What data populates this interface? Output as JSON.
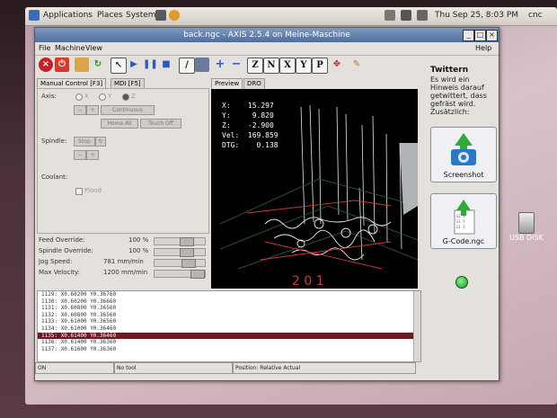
{
  "panel": {
    "menus": [
      "Applications",
      "Places",
      "System"
    ],
    "clock": "Thu Sep 25,  8:03 PM",
    "user": "cnc"
  },
  "desktop": {
    "usb_label": "USB DISK"
  },
  "window": {
    "title": "back.ngc - AXIS 2.5.4 on Meine-Maschine",
    "menu": [
      "File",
      "Machine",
      "View"
    ],
    "help": "Help"
  },
  "toolbar": {
    "letter_buttons": [
      "Z",
      "N",
      "X",
      "Y",
      "P"
    ]
  },
  "tabs": {
    "manual": "Manual Control [F3]",
    "mdi": "MDI [F5]"
  },
  "controls": {
    "axis_label": "Axis:",
    "axes": [
      "X",
      "Y",
      "Z"
    ],
    "selected_axis": "Z",
    "jog_mode": "Continuous",
    "home_all": "Home All",
    "touch_off": "Touch Off",
    "spindle_label": "Spindle:",
    "spindle_stop": "Stop",
    "coolant_label": "Coolant:",
    "flood": "Flood",
    "feed_override_label": "Feed Override:",
    "feed_override_value": "100 %",
    "spindle_override_label": "Spindle Override:",
    "spindle_override_value": "100 %",
    "jog_speed_label": "Jog Speed:",
    "jog_speed_value": "781 mm/min",
    "max_velocity_label": "Max Velocity:",
    "max_velocity_value": "1200 mm/min"
  },
  "preview_tabs": {
    "preview": "Preview",
    "dro": "DRO"
  },
  "dro": [
    {
      "axis": "X:",
      "value": "15.297"
    },
    {
      "axis": "Y:",
      "value": "9.820"
    },
    {
      "axis": "Z:",
      "value": "-2.900"
    },
    {
      "axis": "Vel:",
      "value": "169.859"
    },
    {
      "axis": "DTG:",
      "value": "0.138"
    }
  ],
  "twitter": {
    "heading": "Twittern",
    "text": "Es wird ein Hinweis darauf getwittert, dass gefräst wird. Zusätzlich:",
    "screenshot_button": "Screenshot",
    "gcode_button": "G-Code.ngc"
  },
  "gcode": [
    {
      "num": "1129:",
      "code": "X0.60200 Y0.36760",
      "active": false
    },
    {
      "num": "1130:",
      "code": "X0.60200 Y0.36660",
      "active": false
    },
    {
      "num": "1131:",
      "code": "X0.60800 Y0.36560",
      "active": false
    },
    {
      "num": "1132:",
      "code": "X0.60800 Y0.36560",
      "active": false
    },
    {
      "num": "1133:",
      "code": "X0.61000 Y0.36560",
      "active": false
    },
    {
      "num": "1134:",
      "code": "X0.61000 Y0.36460",
      "active": false
    },
    {
      "num": "1135:",
      "code": "X0.61400 Y0.36460",
      "active": true
    },
    {
      "num": "1136:",
      "code": "X0.61400 Y0.36360",
      "active": false
    },
    {
      "num": "1137:",
      "code": "X0.61600 Y0.36360",
      "active": false
    }
  ],
  "status": {
    "state": "ON",
    "tool": "No tool",
    "position": "Position: Relative Actual"
  }
}
